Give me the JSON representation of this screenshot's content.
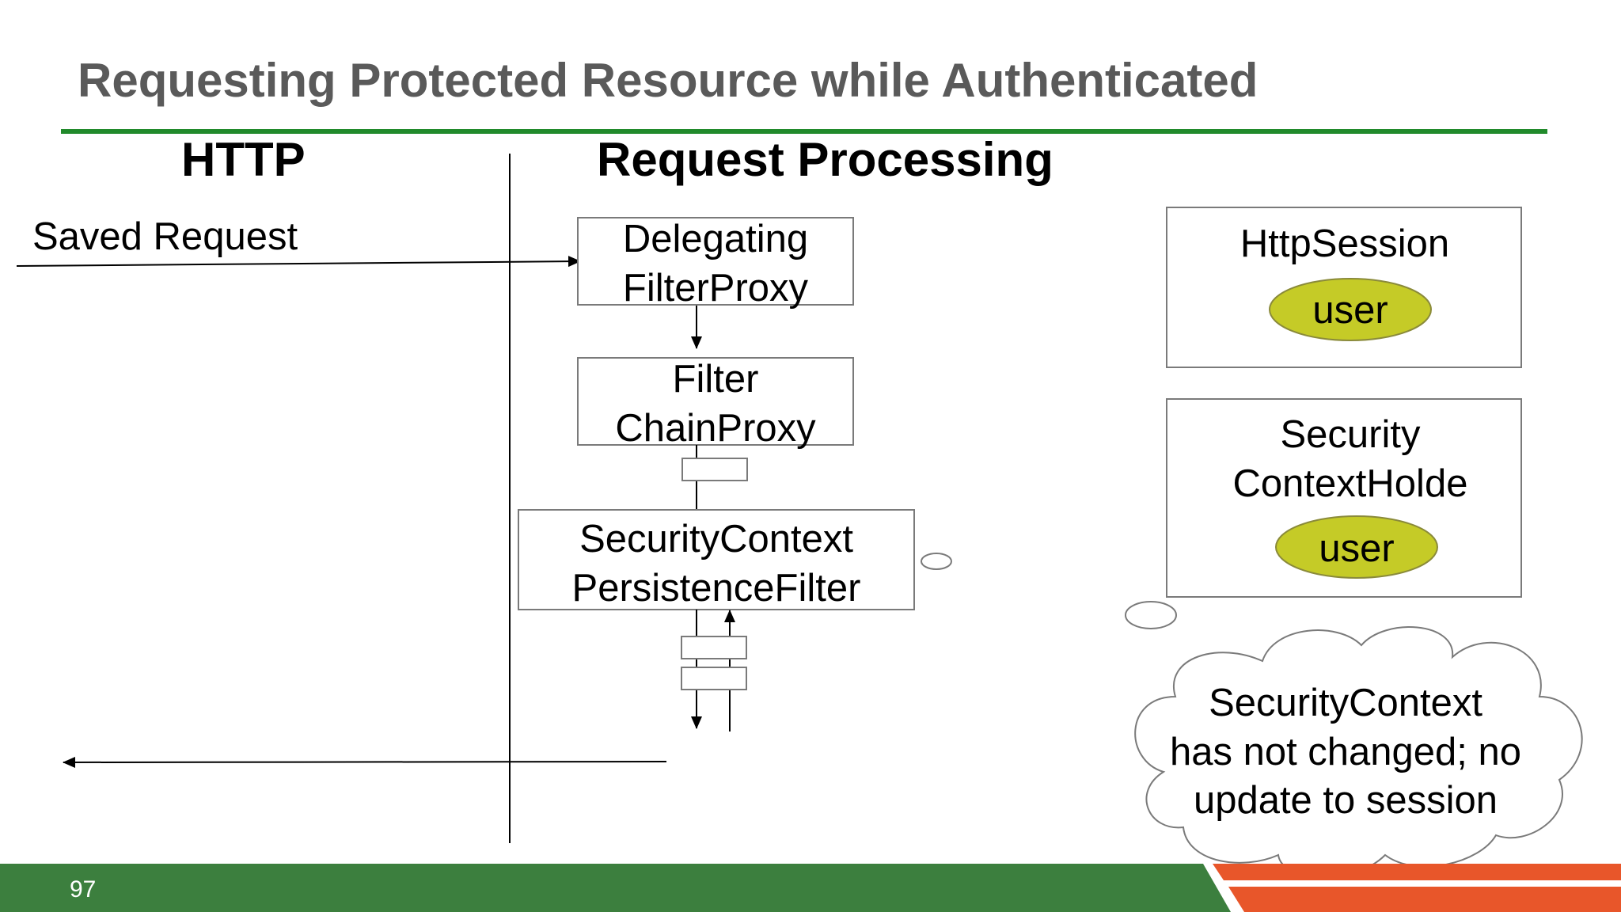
{
  "slide": {
    "title": "Requesting Protected Resource while Authenticated",
    "page_number": "97"
  },
  "columns": {
    "http": "HTTP",
    "processing": "Request Processing"
  },
  "http": {
    "saved_request": "Saved Request"
  },
  "filters": {
    "delegating_line1": "Delegating",
    "delegating_line2": "FilterProxy",
    "chain_line1": "Filter",
    "chain_line2": "ChainProxy",
    "persistence_line1": "SecurityContext",
    "persistence_line2": "PersistenceFilter"
  },
  "session": {
    "title": "HttpSession",
    "user": "user"
  },
  "holder": {
    "line1": "Security",
    "line2": "ContextHolde",
    "user": "user"
  },
  "thought": {
    "line1": "SecurityContext",
    "line2": "has not changed; no",
    "line3": "update to session"
  },
  "colors": {
    "title_gray": "#5a5a5a",
    "rule_green": "#218a2b",
    "footer_green": "#3c7f3e",
    "accent_orange": "#e8562a",
    "user_oval": "#c5cb27"
  }
}
